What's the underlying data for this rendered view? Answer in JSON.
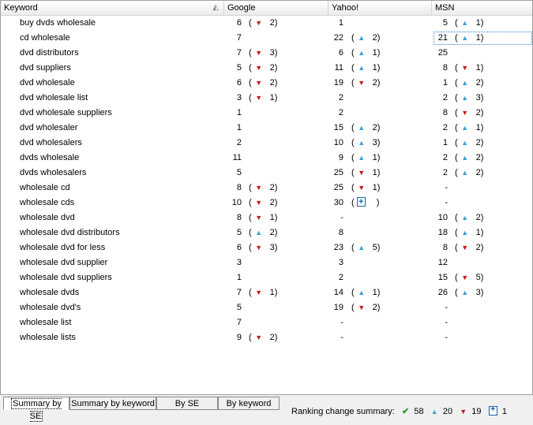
{
  "columns": {
    "keyword": "Keyword",
    "google": "Google",
    "yahoo": "Yahoo!",
    "msn": "MSN"
  },
  "rows": [
    {
      "keyword": "buy dvds wholesale",
      "google": {
        "rank": "6",
        "dir": "down",
        "delta": "2"
      },
      "yahoo": {
        "rank": "1",
        "dir": "",
        "delta": ""
      },
      "msn": {
        "rank": "5",
        "dir": "up",
        "delta": "1"
      }
    },
    {
      "keyword": "cd wholesale",
      "google": {
        "rank": "7",
        "dir": "",
        "delta": ""
      },
      "yahoo": {
        "rank": "22",
        "dir": "up",
        "delta": "2"
      },
      "msn": {
        "rank": "21",
        "dir": "up",
        "delta": "1"
      }
    },
    {
      "keyword": "dvd distributors",
      "google": {
        "rank": "7",
        "dir": "down",
        "delta": "3"
      },
      "yahoo": {
        "rank": "6",
        "dir": "up",
        "delta": "1"
      },
      "msn": {
        "rank": "25",
        "dir": "",
        "delta": ""
      }
    },
    {
      "keyword": "dvd suppliers",
      "google": {
        "rank": "5",
        "dir": "down",
        "delta": "2"
      },
      "yahoo": {
        "rank": "11",
        "dir": "up",
        "delta": "1"
      },
      "msn": {
        "rank": "8",
        "dir": "down",
        "delta": "1"
      }
    },
    {
      "keyword": "dvd wholesale",
      "google": {
        "rank": "6",
        "dir": "down",
        "delta": "2"
      },
      "yahoo": {
        "rank": "19",
        "dir": "down",
        "delta": "2"
      },
      "msn": {
        "rank": "1",
        "dir": "up",
        "delta": "2"
      }
    },
    {
      "keyword": "dvd wholesale list",
      "google": {
        "rank": "3",
        "dir": "down",
        "delta": "1"
      },
      "yahoo": {
        "rank": "2",
        "dir": "",
        "delta": ""
      },
      "msn": {
        "rank": "2",
        "dir": "up",
        "delta": "3"
      }
    },
    {
      "keyword": "dvd wholesale suppliers",
      "google": {
        "rank": "1",
        "dir": "",
        "delta": ""
      },
      "yahoo": {
        "rank": "2",
        "dir": "",
        "delta": ""
      },
      "msn": {
        "rank": "8",
        "dir": "down",
        "delta": "2"
      }
    },
    {
      "keyword": "dvd wholesaler",
      "google": {
        "rank": "1",
        "dir": "",
        "delta": ""
      },
      "yahoo": {
        "rank": "15",
        "dir": "up",
        "delta": "2"
      },
      "msn": {
        "rank": "2",
        "dir": "up",
        "delta": "1"
      }
    },
    {
      "keyword": "dvd wholesalers",
      "google": {
        "rank": "2",
        "dir": "",
        "delta": ""
      },
      "yahoo": {
        "rank": "10",
        "dir": "up",
        "delta": "3"
      },
      "msn": {
        "rank": "1",
        "dir": "up",
        "delta": "2"
      }
    },
    {
      "keyword": "dvds wholesale",
      "google": {
        "rank": "11",
        "dir": "",
        "delta": ""
      },
      "yahoo": {
        "rank": "9",
        "dir": "up",
        "delta": "1"
      },
      "msn": {
        "rank": "2",
        "dir": "up",
        "delta": "2"
      }
    },
    {
      "keyword": "dvds wholesalers",
      "google": {
        "rank": "5",
        "dir": "",
        "delta": ""
      },
      "yahoo": {
        "rank": "25",
        "dir": "down",
        "delta": "1"
      },
      "msn": {
        "rank": "2",
        "dir": "up",
        "delta": "2"
      }
    },
    {
      "keyword": "wholesale cd",
      "google": {
        "rank": "8",
        "dir": "down",
        "delta": "2"
      },
      "yahoo": {
        "rank": "25",
        "dir": "down",
        "delta": "1"
      },
      "msn": {
        "rank": "-",
        "dir": "",
        "delta": ""
      }
    },
    {
      "keyword": "wholesale cds",
      "google": {
        "rank": "10",
        "dir": "down",
        "delta": "2"
      },
      "yahoo": {
        "rank": "30",
        "dir": "new",
        "delta": ""
      },
      "msn": {
        "rank": "-",
        "dir": "",
        "delta": ""
      }
    },
    {
      "keyword": "wholesale dvd",
      "google": {
        "rank": "8",
        "dir": "down",
        "delta": "1"
      },
      "yahoo": {
        "rank": "-",
        "dir": "",
        "delta": ""
      },
      "msn": {
        "rank": "10",
        "dir": "up",
        "delta": "2"
      }
    },
    {
      "keyword": "wholesale dvd distributors",
      "google": {
        "rank": "5",
        "dir": "up",
        "delta": "2"
      },
      "yahoo": {
        "rank": "8",
        "dir": "",
        "delta": ""
      },
      "msn": {
        "rank": "18",
        "dir": "up",
        "delta": "1"
      }
    },
    {
      "keyword": "wholesale dvd for less",
      "google": {
        "rank": "6",
        "dir": "down",
        "delta": "3"
      },
      "yahoo": {
        "rank": "23",
        "dir": "up",
        "delta": "5"
      },
      "msn": {
        "rank": "8",
        "dir": "down",
        "delta": "2"
      }
    },
    {
      "keyword": "wholesale dvd supplier",
      "google": {
        "rank": "3",
        "dir": "",
        "delta": ""
      },
      "yahoo": {
        "rank": "3",
        "dir": "",
        "delta": ""
      },
      "msn": {
        "rank": "12",
        "dir": "",
        "delta": ""
      }
    },
    {
      "keyword": "wholesale dvd suppliers",
      "google": {
        "rank": "1",
        "dir": "",
        "delta": ""
      },
      "yahoo": {
        "rank": "2",
        "dir": "",
        "delta": ""
      },
      "msn": {
        "rank": "15",
        "dir": "down",
        "delta": "5"
      }
    },
    {
      "keyword": "wholesale dvds",
      "google": {
        "rank": "7",
        "dir": "down",
        "delta": "1"
      },
      "yahoo": {
        "rank": "14",
        "dir": "up",
        "delta": "1"
      },
      "msn": {
        "rank": "26",
        "dir": "up",
        "delta": "3"
      }
    },
    {
      "keyword": "wholesale dvd's",
      "google": {
        "rank": "5",
        "dir": "",
        "delta": ""
      },
      "yahoo": {
        "rank": "19",
        "dir": "down",
        "delta": "2"
      },
      "msn": {
        "rank": "-",
        "dir": "",
        "delta": ""
      }
    },
    {
      "keyword": "wholesale list",
      "google": {
        "rank": "7",
        "dir": "",
        "delta": ""
      },
      "yahoo": {
        "rank": "-",
        "dir": "",
        "delta": ""
      },
      "msn": {
        "rank": "-",
        "dir": "",
        "delta": ""
      }
    },
    {
      "keyword": "wholesale lists",
      "google": {
        "rank": "9",
        "dir": "down",
        "delta": "2"
      },
      "yahoo": {
        "rank": "-",
        "dir": "",
        "delta": ""
      },
      "msn": {
        "rank": "-",
        "dir": "",
        "delta": ""
      }
    }
  ],
  "tabs": [
    {
      "label": "Summary by SE",
      "active": true
    },
    {
      "label": "Summary by keyword",
      "active": false
    },
    {
      "label": "By SE",
      "active": false
    },
    {
      "label": "By keyword",
      "active": false
    }
  ],
  "summary": {
    "label": "Ranking change summary:",
    "unchanged": "58",
    "up": "20",
    "down": "19",
    "new": "1"
  },
  "icons": {
    "up": "triangle-up-icon",
    "down": "triangle-down-icon",
    "new": "new-entry-icon",
    "check": "check-icon"
  },
  "colors": {
    "up": "#3da0d8",
    "down": "#c41a1a",
    "check": "#1c9c2c",
    "new": "#1a5fb4"
  }
}
